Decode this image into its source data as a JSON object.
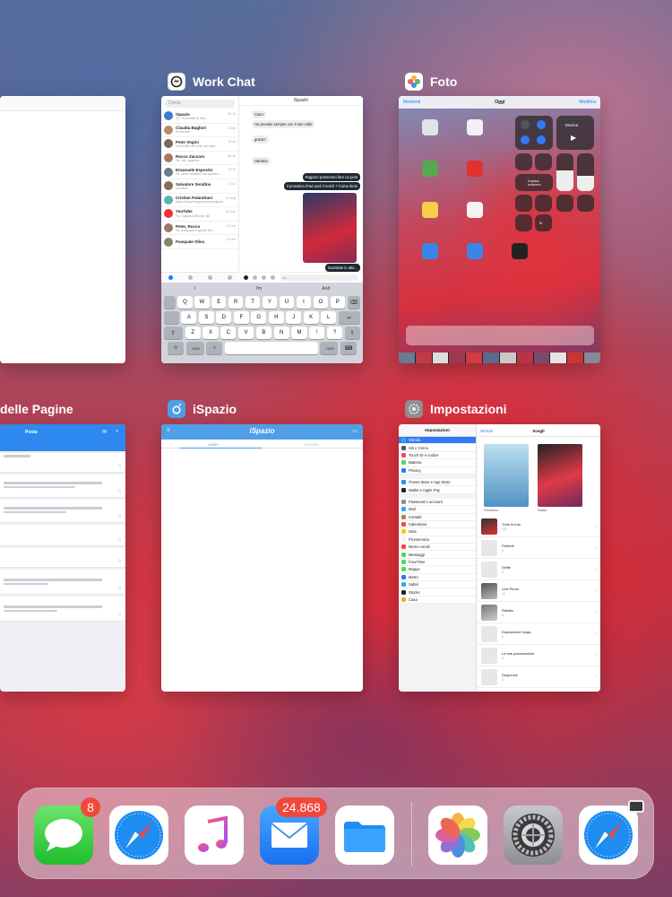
{
  "switcher": {
    "cards": {
      "partial_top": {},
      "work_chat": {
        "title": "Work Chat",
        "search_placeholder": "Cerca",
        "contacts": [
          {
            "name": "iSpazio",
            "preview": "Tu: Guardate in alto...",
            "time": "09:12"
          },
          {
            "name": "Claudia Bagliori",
            "preview": "A Internet",
            "time": "23:46"
          },
          {
            "name": "Peter Vogini",
            "preview": "Ho scritto ad Hilly hai visto...",
            "time": "16:44"
          },
          {
            "name": "Rocco Zaccaro",
            "preview": "Tu: vai, appena...",
            "time": "08:26"
          },
          {
            "name": "Emanuele Esposito",
            "preview": "Tu: devo mettere ora questo...",
            "time": "10:11"
          },
          {
            "name": "Salvatore Serafino",
            "preview": "va bene",
            "time": "17:02"
          },
          {
            "name": "Cristian Palandrani",
            "preview": "https://www.thepremierdesignstore...",
            "time": "11 mag"
          },
          {
            "name": "YouTube",
            "preview": "Tu: Capisco Mondo 😀",
            "time": "29 mar"
          },
          {
            "name": "Peter, Rocco",
            "preview": "Tu: svilupperò questi ele...",
            "time": "22 feb"
          },
          {
            "name": "Pasquale Oliva",
            "preview": "",
            "time": "12 feb"
          }
        ],
        "chat_title": "iSpazio",
        "messages_in": [
          "Ciao!",
          "Ho provato sempre con il mio volto",
          "grazie!",
          "Hahaha"
        ],
        "messages_out": [
          "Ragazzi potremmo fare un post",
          "Il prossimo iPad avrà il notch ? Come titolo",
          "Guardate in alto..."
        ],
        "compose_placeholder": "Aa",
        "keyboard": {
          "suggestions": [
            "I",
            "I'm",
            "And"
          ],
          "row1": [
            "Q",
            "W",
            "E",
            "R",
            "T",
            "Y",
            "U",
            "I",
            "O",
            "P"
          ],
          "row2": [
            "A",
            "S",
            "D",
            "F",
            "G",
            "H",
            "J",
            "K",
            "L"
          ],
          "row3": [
            "Z",
            "X",
            "C",
            "V",
            "B",
            "N",
            "M",
            "!",
            "?"
          ],
          "key_num": ".?123"
        }
      },
      "foto": {
        "title": "Foto",
        "nav_back": "Momenti",
        "nav_title": "Oggi",
        "nav_edit": "Modifica",
        "cc_music": "Musica",
        "cc_mirror": "Duplica schermo",
        "cc_appletv": "tv"
      },
      "pagine": {
        "title": "delle Pagine",
        "header": "Posta"
      },
      "ispazio": {
        "title": "iSpazio",
        "logo": "iSpazio",
        "tab_home": "HOME",
        "tab_news": "NOTIZIE"
      },
      "impostazioni": {
        "title": "Impostazioni",
        "left_title": "Impostazioni",
        "back_label": "Sfondo",
        "right_title": "Scegli",
        "items_group1": [
          "Sfondo",
          "Siri e Cerca",
          "Touch ID e codice",
          "Batteria",
          "Privacy"
        ],
        "items_group2": [
          "iTunes Store e App Store",
          "Wallet e Apple Pay"
        ],
        "items_group3": [
          "Password e account",
          "Mail",
          "Contatti",
          "Calendario",
          "Note",
          "Promemoria",
          "Memo vocali",
          "Messaggi",
          "FaceTime",
          "Mappe",
          "Metro",
          "Safari",
          "Stocks",
          "Casa"
        ],
        "wallpaper_labels": [
          "Dinamico",
          "Statici"
        ],
        "albums": [
          {
            "name": "Tutte le foto",
            "count": "124"
          },
          {
            "name": "Preferiti",
            "count": "0"
          },
          {
            "name": "Selfie",
            "count": "0"
          },
          {
            "name": "Live Photo",
            "count": "12"
          },
          {
            "name": "Ritratto",
            "count": "0"
          },
          {
            "name": "Esposizione lunga",
            "count": "0"
          },
          {
            "name": "Le mie panoramiche",
            "count": "0"
          },
          {
            "name": "Sequenze",
            "count": "0"
          }
        ]
      }
    }
  },
  "dock": {
    "messages_badge": "8",
    "mail_badge": "24.868",
    "apps": [
      "Messaggi",
      "Safari",
      "Musica",
      "Mail",
      "File",
      "Foto",
      "Impostazioni",
      "Safari"
    ]
  },
  "colors": {
    "accent": "#3478f6",
    "badge": "#f2483b",
    "ispazio": "#4f9fe8"
  }
}
